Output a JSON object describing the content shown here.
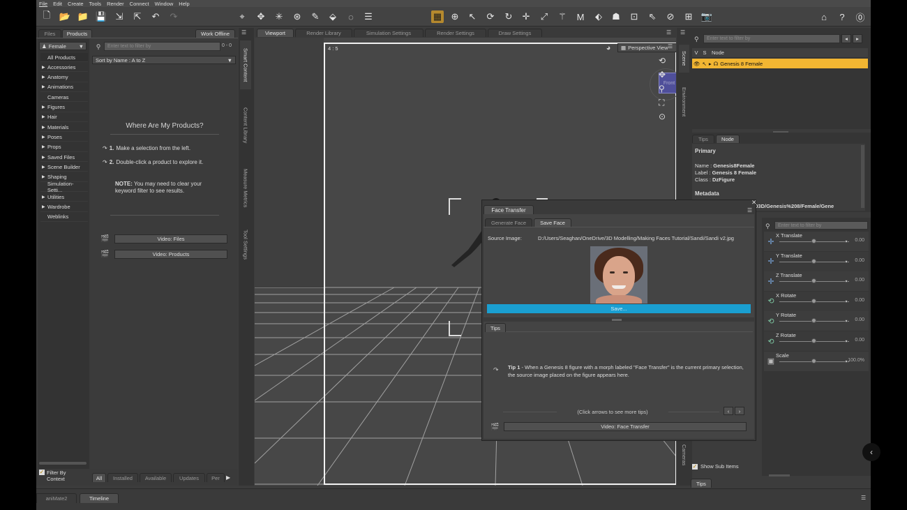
{
  "menu": [
    "File",
    "Edit",
    "Create",
    "Tools",
    "Render",
    "Connect",
    "Window",
    "Help"
  ],
  "toolbar_icons": {
    "file": [
      "new-file-icon",
      "open-folder-icon",
      "open-recent-icon",
      "save-icon",
      "import-icon",
      "export-icon",
      "undo-icon",
      "redo-icon"
    ],
    "center": [
      "node-selection-icon",
      "universal-tool-icon",
      "joint-editor-icon",
      "geometry-editor-icon",
      "surface-selection-icon",
      "region-navigator-icon",
      "spot-render-icon",
      "list-icon"
    ],
    "right": [
      "scene-settings-icon",
      "world-tool-icon",
      "pointer-icon",
      "rotate-tool-icon",
      "twist-icon",
      "translate-icon",
      "scale-icon",
      "figure-icon",
      "sculpt-icon",
      "morph-icon",
      "pose-icon",
      "camera-rig-icon",
      "camera-icon"
    ],
    "far": [
      "home-icon",
      "help-icon",
      "whats-this-icon"
    ]
  },
  "left_panel": {
    "tabs": [
      "Files",
      "Products"
    ],
    "work_offline": "Work Offline",
    "category_select": "Female",
    "filter_placeholder": "Enter text to filter by",
    "filter_count": "0 - 0",
    "sort_select": "Sort by Name : A to Z",
    "categories": [
      {
        "label": "All Products",
        "arrow": ""
      },
      {
        "label": "Accessories",
        "arrow": "▶"
      },
      {
        "label": "Anatomy",
        "arrow": "▶"
      },
      {
        "label": "Animations",
        "arrow": "▶"
      },
      {
        "label": "Cameras",
        "arrow": ""
      },
      {
        "label": "Figures",
        "arrow": "▶"
      },
      {
        "label": "Hair",
        "arrow": "▶"
      },
      {
        "label": "Materials",
        "arrow": "▶"
      },
      {
        "label": "Poses",
        "arrow": "▶"
      },
      {
        "label": "Props",
        "arrow": "▶"
      },
      {
        "label": "Saved Files",
        "arrow": "▶"
      },
      {
        "label": "Scene Builder",
        "arrow": "▶"
      },
      {
        "label": "Shaping",
        "arrow": "▶"
      },
      {
        "label": "Simulation-Setti...",
        "arrow": ""
      },
      {
        "label": "Utilities",
        "arrow": "▶"
      },
      {
        "label": "Wardrobe",
        "arrow": "▶"
      },
      {
        "label": "Weblinks",
        "arrow": ""
      }
    ],
    "where_title": "Where Are My Products?",
    "step1_num": "1.",
    "step1_text": "Make a selection from the left.",
    "step2_num": "2.",
    "step2_text": "Double-click a product to explore it.",
    "note_label": "NOTE:",
    "note_text": "You may need to clear your keyword filter to see results.",
    "video_files": "Video: Files",
    "video_products": "Video: Products",
    "filter_by_context": "Filter By Context",
    "bottom_tabs": [
      "All",
      "Installed",
      "Available",
      "Updates",
      "Per"
    ]
  },
  "side_vtabs": [
    "Smart Content",
    "Content Library",
    "Measure Metrics",
    "Tool Settings"
  ],
  "viewport": {
    "tabs": [
      "Viewport",
      "Render Library",
      "Simulation Settings",
      "Render Settings",
      "Draw Settings"
    ],
    "aspect": "4 : 5",
    "view_select": "Perspective View",
    "cube_label": "Front"
  },
  "face_transfer": {
    "title": "Face Transfer",
    "tabs": [
      "Generate Face",
      "Save Face"
    ],
    "source_label": "Source Image:",
    "source_path": "D:/Users/Seaghan/OneDrive/3D Modelling/Making Faces Tutorial/Sandi/Sandi v2.jpg",
    "save_button": "Save...",
    "tips_tab": "Tips",
    "tip_label": "Tip 1",
    "tip_text": " - When a Genesis 8 figure with a morph labeled \"Face Transfer\" is the current primary selection, the source image placed on the figure appears here.",
    "tips_nav": "(Click arrows to see more tips)",
    "video_face": "Video: Face Transfer"
  },
  "scene_panel": {
    "vtabs": [
      "Scene",
      "Environment"
    ],
    "filter_placeholder": "Enter text to filter by",
    "columns": [
      "V",
      "S",
      "Node"
    ],
    "node": "Genesis 8 Female"
  },
  "node_panel": {
    "tabs": [
      "Tips",
      "Node"
    ],
    "primary": "Primary",
    "name_label": "Name :",
    "name_value": "Genesis8Female",
    "label_label": "Label :",
    "label_value": "Genesis 8 Female",
    "class_label": "Class :",
    "class_value": "DzFigure",
    "metadata": "Metadata",
    "metadata_path": "DAZ%203D/Genesis%208/Female/Gene"
  },
  "params_panel": {
    "filter_placeholder": "Enter text to filter by",
    "rows": [
      {
        "label": "X Translate",
        "value": "0.00",
        "icon": "translate-icon",
        "pos": 0.5
      },
      {
        "label": "Y Translate",
        "value": "0.00",
        "icon": "translate-icon",
        "pos": 0.5
      },
      {
        "label": "Z Translate",
        "value": "0.00",
        "icon": "translate-icon",
        "pos": 0.5
      },
      {
        "label": "X Rotate",
        "value": "0.00",
        "icon": "rotate-icon",
        "pos": 0.5
      },
      {
        "label": "Y Rotate",
        "value": "0.00",
        "icon": "rotate-icon",
        "pos": 0.5
      },
      {
        "label": "Z Rotate",
        "value": "0.00",
        "icon": "rotate-icon",
        "pos": 0.5
      },
      {
        "label": "Scale",
        "value": "100.0%",
        "icon": "scale-icon",
        "pos": 0.5
      }
    ],
    "cameras_vtab": "Cameras",
    "show_sub_items": "Show Sub Items",
    "tips_tab": "Tips"
  },
  "bottom_tabs": [
    "aniMate2",
    "Timeline"
  ],
  "colors": {
    "accent_orange": "#f2b632",
    "save_bar": "#1a9fd1",
    "cube": "#4f4f9a"
  }
}
